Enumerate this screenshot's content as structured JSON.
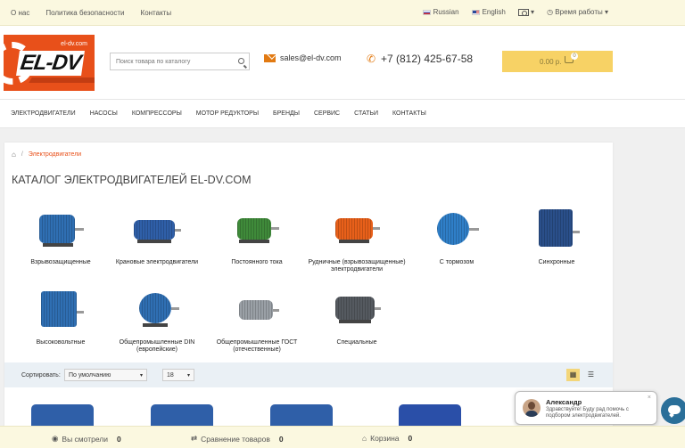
{
  "topbar": {
    "links": [
      "О нас",
      "Политика безопасности",
      "Контакты"
    ],
    "language_ru": "Russian",
    "language_en": "English",
    "currency_icon": "currency-icon",
    "worktime": "Время работы",
    "arrow": "▾"
  },
  "header": {
    "logo_text": "EL-DV",
    "logo_small": "el-dv.com",
    "search_placeholder": "Поиск товара по каталогу",
    "email": "sales@el-dv.com",
    "phone": "+7 (812) 425-67-58",
    "cart_total": "0.00 р.",
    "cart_count": "0"
  },
  "nav": {
    "items": [
      "ЭЛЕКТРОДВИГАТЕЛИ",
      "НАСОСЫ",
      "КОМПРЕССОРЫ",
      "МОТОР РЕДУКТОРЫ",
      "БРЕНДЫ",
      "СЕРВИС",
      "СТАТЬИ",
      "КОНТАКТЫ"
    ]
  },
  "breadcrumb": {
    "home_icon": "home-icon",
    "sep": "/",
    "current": "Электродвигатели"
  },
  "page": {
    "title": "КАТАЛОГ ЭЛЕКТРОДВИГАТЕЛЕЙ EL-DV.COM"
  },
  "categories": [
    {
      "label": "Взрывозащищенные",
      "color": "#2f6fb3"
    },
    {
      "label": "Крановые электродвигатели",
      "color": "#2f5fa8"
    },
    {
      "label": "Постоянного тока",
      "color": "#3f8a3a"
    },
    {
      "label": "Рудничные (взрывозащищенные) электродвигатели",
      "color": "#e8601a"
    },
    {
      "label": "С тормозом",
      "color": "#2f7fc8"
    },
    {
      "label": "Синхронные",
      "color": "#2a4f8a"
    },
    {
      "label": "Высоковольтные",
      "color": "#2f6fb3"
    },
    {
      "label": "Общепромышленные DIN (европейские)",
      "color": "#2f6fb3"
    },
    {
      "label": "Общепромышленные ГОСТ (отечественные)",
      "color": "#9aa0a6"
    },
    {
      "label": "Специальные",
      "color": "#555a60"
    }
  ],
  "sortbar": {
    "sort_label": "Сортировать:",
    "sort_value": "По умолчанию",
    "limit_value": "18",
    "arrow": "▾",
    "grid_icon": "grid-view-icon",
    "list_icon": "list-view-icon"
  },
  "bottombar": {
    "viewed_label": "Вы смотрели",
    "viewed_count": "0",
    "compare_label": "Сравнение товаров",
    "compare_count": "0",
    "cart_label": "Корзина",
    "cart_count": "0"
  },
  "chat": {
    "name": "Александр",
    "message": "Здравствуйте! Буду рад помочь с подбором электродвигателей.",
    "close": "×"
  }
}
